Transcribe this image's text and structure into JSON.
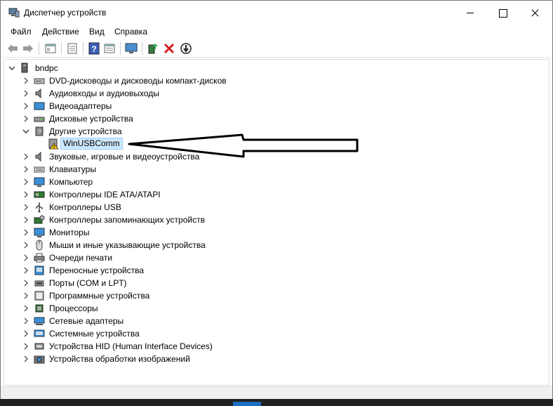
{
  "window": {
    "title": "Диспетчер устройств",
    "menu": [
      "Файл",
      "Действие",
      "Вид",
      "Справка"
    ]
  },
  "toolbar": {
    "buttons": [
      "back-icon",
      "forward-icon",
      "show-hide-tree-icon",
      "properties-icon",
      "help-icon",
      "view-icon",
      "monitor-icon",
      "update-driver-icon",
      "uninstall-icon",
      "scan-hardware-icon"
    ]
  },
  "tree": {
    "root": "bndpc",
    "categories": [
      "DVD-дисководы и дисководы компакт-дисков",
      "Аудиовходы и аудиовыходы",
      "Видеоадаптеры",
      "Дисковые устройства",
      "Другие устройства",
      "Звуковые, игровые и видеоустройства",
      "Клавиатуры",
      "Компьютер",
      "Контроллеры IDE ATA/ATAPI",
      "Контроллеры USB",
      "Контроллеры запоминающих устройств",
      "Мониторы",
      "Мыши и иные указывающие устройства",
      "Очереди печати",
      "Переносные устройства",
      "Порты (COM и LPT)",
      "Программные устройства",
      "Процессоры",
      "Сетевые адаптеры",
      "Системные устройства",
      "Устройства HID (Human Interface Devices)",
      "Устройства обработки изображений"
    ],
    "expanded_child": "WinUSBComm"
  },
  "colors": {
    "selection_bg": "#cce8ff",
    "error_red": "#d42020",
    "warning_yellow": "#f5c400"
  }
}
